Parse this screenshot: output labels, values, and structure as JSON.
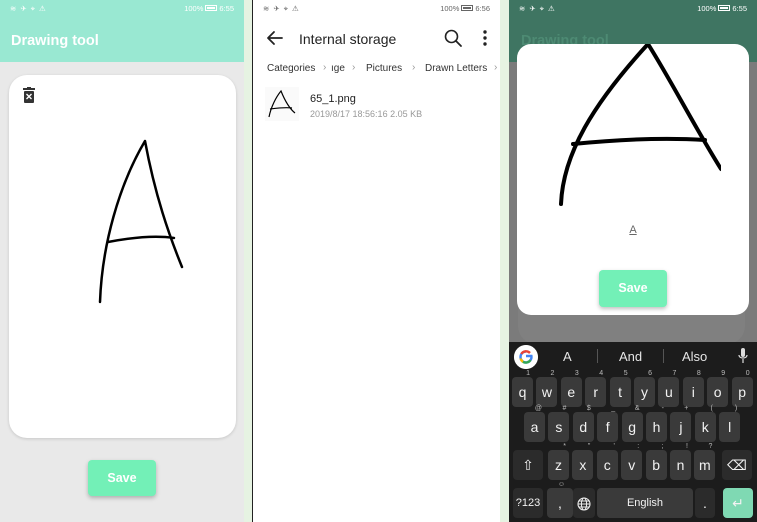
{
  "status": {
    "left_icons": "≋ ✈ ⌖ ⚠",
    "battery_text": "100%",
    "time_1": "6:55",
    "time_2": "6:56",
    "time_3": "6:55"
  },
  "app": {
    "title": "Drawing tool",
    "save_label": "Save",
    "drawn_letter_label": "A",
    "accent_color": "#99e8d2",
    "button_color": "#73f0b7"
  },
  "files": {
    "header_title": "Internal storage",
    "breadcrumbs": [
      "Categories",
      "ıge",
      "Pictures",
      "Drawn Letters"
    ],
    "file_name": "65_1.png",
    "file_meta": "2019/8/17 18:56:16 2.05 KB"
  },
  "keyboard": {
    "suggestions": [
      "A",
      "And",
      "Also"
    ],
    "row1": [
      "q",
      "w",
      "e",
      "r",
      "t",
      "y",
      "u",
      "i",
      "o",
      "p"
    ],
    "row1_hints": [
      "1",
      "2",
      "3",
      "4",
      "5",
      "6",
      "7",
      "8",
      "9",
      "0"
    ],
    "row2": [
      "a",
      "s",
      "d",
      "f",
      "g",
      "h",
      "j",
      "k",
      "l"
    ],
    "row2_hints": [
      "@",
      "#",
      "$",
      "_",
      "&",
      "-",
      "+",
      "(",
      ")"
    ],
    "row3": [
      "z",
      "x",
      "c",
      "v",
      "b",
      "n",
      "m"
    ],
    "row3_hints": [
      "*",
      "\"",
      "'",
      ":",
      ";",
      "!",
      "?"
    ],
    "symbols_label": "?123",
    "emoji_hint": "☺",
    "comma_label": ",",
    "space_label": "English",
    "period_label": "."
  }
}
